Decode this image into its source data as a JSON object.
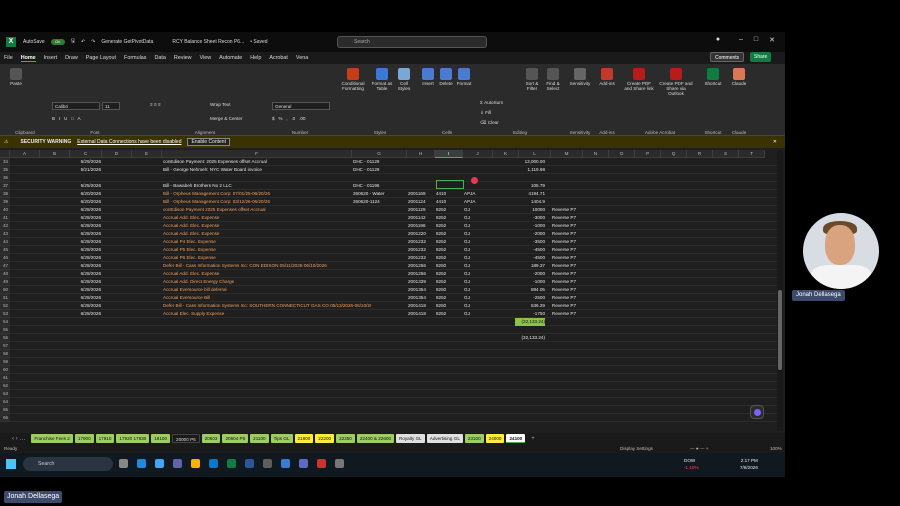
{
  "titlebar": {
    "autosave_label": "AutoSave",
    "autosave_state": "On",
    "macro_label": "Generate GetPivotData",
    "file_title": "RCY Balance Sheet Recon P6...",
    "saved_status": "• Saved",
    "search_placeholder": "Search"
  },
  "menu": {
    "items": [
      "File",
      "Home",
      "Insert",
      "Draw",
      "Page Layout",
      "Formulas",
      "Data",
      "Review",
      "View",
      "Automate",
      "Help",
      "Acrobat",
      "Vena"
    ],
    "active": "Home",
    "comments_label": "Comments",
    "share_label": "Share"
  },
  "ribbon": {
    "font_name": "Calibri",
    "font_size": "11",
    "number_format": "General",
    "wrap_text": "Wrap Text",
    "merge_center": "Merge & Center",
    "conditional_formatting": "Conditional Formatting",
    "format_as_table": "Format as Table",
    "cell_styles": "Cell Styles",
    "insert": "Insert",
    "delete": "Delete",
    "format": "Format",
    "autosum": "AutoSum",
    "fill": "Fill",
    "clear": "Clear",
    "sort_filter": "Sort & Filter",
    "find_select": "Find & Select",
    "sensitivity": "Sensitivity",
    "addins": "Add-ins",
    "create_pdf_link": "Create PDF and Share link",
    "create_pdf_outlook": "Create PDF and Share via Outlook",
    "shortcut": "Shortcut",
    "claude": "Claude",
    "paste": "Paste",
    "groups": [
      "Clipboard",
      "Font",
      "Alignment",
      "Number",
      "Styles",
      "Cells",
      "Editing",
      "Sensitivity",
      "Add-ins",
      "Adobe Acrobat",
      "Shortcut",
      "Claude"
    ]
  },
  "warning": {
    "title": "SECURITY WARNING",
    "message": "External Data Connections have been disabled",
    "button": "Enable Content"
  },
  "formula_bar": {
    "name_box": "I55",
    "fx": "fx"
  },
  "columns": [
    "A",
    "B",
    "C",
    "D",
    "E",
    "F",
    "G",
    "H",
    "I",
    "J",
    "K",
    "L",
    "M",
    "N",
    "O",
    "P",
    "Q",
    "R",
    "S",
    "T"
  ],
  "rows": [
    {
      "n": "34",
      "date": "5/29/2026",
      "desc": "conEdison Payment: 2025 Expenses offset Accrual",
      "g": "DHC - 01129",
      "h": "",
      "i": "",
      "j": "",
      "l": "13,000.00",
      "m": "",
      "desc_orange": false
    },
    {
      "n": "35",
      "date": "5/21/2026",
      "desc": "Bill - George Nehmeh: NYC Water Board invoice",
      "g": "DHC - 01129",
      "h": "",
      "i": "",
      "j": "",
      "l": "1,119.98",
      "m": "",
      "desc_orange": false
    },
    {
      "n": "36",
      "date": "",
      "desc": "",
      "g": "",
      "h": "",
      "i": "",
      "j": "",
      "l": "",
      "m": "",
      "desc_orange": false
    },
    {
      "n": "37",
      "date": "5/25/2026",
      "desc": "Bill - Bawabeh Brothers No 2 LLC",
      "g": "DHC - 01196",
      "h": "",
      "i": "",
      "j": "",
      "l": "105.79",
      "m": "",
      "desc_orange": false
    },
    {
      "n": "38",
      "date": "6/20/2026",
      "desc": "Bill - Orpheus Management Corp: 07/01/25-06/20/26",
      "g": "260620 - Water",
      "h": "2001169",
      "i": "4410",
      "j": "APJA",
      "l": "4194.71",
      "m": "",
      "desc_orange": true
    },
    {
      "n": "39",
      "date": "6/20/2026",
      "desc": "Bill - Orpheus Management Corp: 03/12/26-06/20/26",
      "g": "260620-1124",
      "h": "2001124",
      "i": "4410",
      "j": "APJA",
      "l": "1404.9",
      "m": "",
      "desc_orange": true
    },
    {
      "n": "40",
      "date": "6/28/2026",
      "desc": "conEdison Payment 2025 Expenses offset Accrual",
      "g": "",
      "h": "2001129",
      "i": "8252",
      "j": "GJ",
      "l": "10000",
      "m": "Reverse P7",
      "desc_orange": true
    },
    {
      "n": "41",
      "date": "6/28/2026",
      "desc": "Accrual Add. Elec. Expense",
      "g": "",
      "h": "2001142",
      "i": "8252",
      "j": "GJ",
      "l": "-3000",
      "m": "Reverse P7",
      "desc_orange": true
    },
    {
      "n": "42",
      "date": "6/28/2026",
      "desc": "Accrual Add. Elec. Expense",
      "g": "",
      "h": "2001196",
      "i": "8252",
      "j": "GJ",
      "l": "-1000",
      "m": "Reverse P7",
      "desc_orange": true
    },
    {
      "n": "43",
      "date": "6/28/2026",
      "desc": "Accrual Add. Elec. Expense",
      "g": "",
      "h": "2001220",
      "i": "8252",
      "j": "GJ",
      "l": "-2000",
      "m": "Reverse P7",
      "desc_orange": true
    },
    {
      "n": "44",
      "date": "6/28/2026",
      "desc": "Accrual P4 Elec. Expense",
      "g": "",
      "h": "2001232",
      "i": "8252",
      "j": "GJ",
      "l": "-3500",
      "m": "Reverse P7",
      "desc_orange": true
    },
    {
      "n": "45",
      "date": "6/28/2026",
      "desc": "Accrual P5 Elec. Expense",
      "g": "",
      "h": "2001232",
      "i": "8252",
      "j": "GJ",
      "l": "-4500",
      "m": "Reverse P7",
      "desc_orange": true
    },
    {
      "n": "46",
      "date": "6/28/2026",
      "desc": "Accrual P6 Elec. Expense",
      "g": "",
      "h": "2001232",
      "i": "8252",
      "j": "GJ",
      "l": "-4500",
      "m": "Reverse P7",
      "desc_orange": true
    },
    {
      "n": "47",
      "date": "6/28/2026",
      "desc": "Defer Bill - Cass Information Systems Inc: CON EDISON 05/11/2026-06/10/2026",
      "g": "",
      "h": "2001256",
      "i": "8250",
      "j": "GJ",
      "l": "189.37",
      "m": "Reverse P7",
      "desc_orange": true
    },
    {
      "n": "48",
      "date": "6/28/2026",
      "desc": "Accrual Add. Elec. Expense",
      "g": "",
      "h": "2001256",
      "i": "8252",
      "j": "GJ",
      "l": "-2000",
      "m": "Reverse P7",
      "desc_orange": true
    },
    {
      "n": "49",
      "date": "6/28/2026",
      "desc": "Accrual Add. Direct Energy Charge",
      "g": "",
      "h": "2001339",
      "i": "8252",
      "j": "GJ",
      "l": "-1000",
      "m": "Reverse P7",
      "desc_orange": true
    },
    {
      "n": "50",
      "date": "6/28/2026",
      "desc": "Accrual Eversource bill deferral",
      "g": "",
      "h": "2001354",
      "i": "8250",
      "j": "GJ",
      "l": "894.05",
      "m": "Reverse P7",
      "desc_orange": true
    },
    {
      "n": "51",
      "date": "6/28/2026",
      "desc": "Accrual Eversource Bill",
      "g": "",
      "h": "2001354",
      "i": "8252",
      "j": "GJ",
      "l": "-2500",
      "m": "Reverse P7",
      "desc_orange": true
    },
    {
      "n": "52",
      "date": "6/28/2026",
      "desc": "Defer Bill - Cass Information Systems Inc: SOUTHERN CONNECTICUT GAS CO 05/13/2026-06/10/2026",
      "g": "",
      "h": "2001418",
      "i": "8250",
      "j": "GJ",
      "l": "536.29",
      "m": "Reverse P7",
      "desc_orange": true
    },
    {
      "n": "53",
      "date": "6/28/2026",
      "desc": "Accrual Elec. Supply Expense",
      "g": "",
      "h": "2001418",
      "i": "8252",
      "j": "GJ",
      "l": "-1750",
      "m": "Reverse P7",
      "desc_orange": true
    },
    {
      "n": "54",
      "date": "",
      "desc": "",
      "g": "",
      "h": "",
      "i": "",
      "j": "",
      "l": "(32,133.24)",
      "m": "",
      "desc_orange": false,
      "l_green": true
    },
    {
      "n": "55",
      "date": "",
      "desc": "",
      "g": "",
      "h": "",
      "i": "",
      "j": "",
      "l": "",
      "m": "",
      "desc_orange": false
    },
    {
      "n": "56",
      "date": "",
      "desc": "",
      "g": "",
      "h": "",
      "i": "",
      "j": "",
      "l": "(32,133.24)",
      "m": "",
      "desc_orange": false
    },
    {
      "n": "57",
      "date": "",
      "desc": "",
      "g": "",
      "h": "",
      "i": "",
      "j": "",
      "l": "",
      "m": "",
      "desc_orange": false
    },
    {
      "n": "58",
      "date": "",
      "desc": "",
      "g": "",
      "h": "",
      "i": "",
      "j": "",
      "l": "",
      "m": "",
      "desc_orange": false
    },
    {
      "n": "59",
      "date": "",
      "desc": "",
      "g": "",
      "h": "",
      "i": "",
      "j": "",
      "l": "",
      "m": "",
      "desc_orange": false
    },
    {
      "n": "60",
      "date": "",
      "desc": "",
      "g": "",
      "h": "",
      "i": "",
      "j": "",
      "l": "",
      "m": "",
      "desc_orange": false
    },
    {
      "n": "61",
      "date": "",
      "desc": "",
      "g": "",
      "h": "",
      "i": "",
      "j": "",
      "l": "",
      "m": "",
      "desc_orange": false
    },
    {
      "n": "62",
      "date": "",
      "desc": "",
      "g": "",
      "h": "",
      "i": "",
      "j": "",
      "l": "",
      "m": "",
      "desc_orange": false
    },
    {
      "n": "63",
      "date": "",
      "desc": "",
      "g": "",
      "h": "",
      "i": "",
      "j": "",
      "l": "",
      "m": "",
      "desc_orange": false
    },
    {
      "n": "64",
      "date": "",
      "desc": "",
      "g": "",
      "h": "",
      "i": "",
      "j": "",
      "l": "",
      "m": "",
      "desc_orange": false
    },
    {
      "n": "65",
      "date": "",
      "desc": "",
      "g": "",
      "h": "",
      "i": "",
      "j": "",
      "l": "",
      "m": "",
      "desc_orange": false
    },
    {
      "n": "66",
      "date": "",
      "desc": "",
      "g": "",
      "h": "",
      "i": "",
      "j": "",
      "l": "",
      "m": "",
      "desc_orange": false
    }
  ],
  "sheet_tabs": [
    {
      "label": "Franchise Fees 2",
      "style": "g"
    },
    {
      "label": "17900",
      "style": "g"
    },
    {
      "label": "17910",
      "style": "g"
    },
    {
      "label": "17920 17930",
      "style": "g"
    },
    {
      "label": "18100",
      "style": "g"
    },
    {
      "label": "20000 P6",
      "style": "d"
    },
    {
      "label": "20603",
      "style": "g"
    },
    {
      "label": "20604 P6",
      "style": "g"
    },
    {
      "label": "21100",
      "style": "g"
    },
    {
      "label": "Tips GL",
      "style": "g"
    },
    {
      "label": "21800",
      "style": "y"
    },
    {
      "label": "22200",
      "style": "y"
    },
    {
      "label": "22350",
      "style": "g"
    },
    {
      "label": "22400 & 22600",
      "style": "g"
    },
    {
      "label": "Royalty GL",
      "style": "w"
    },
    {
      "label": "Advertising GL",
      "style": "w"
    },
    {
      "label": "23100",
      "style": "g"
    },
    {
      "label": "24000",
      "style": "y"
    },
    {
      "label": "24100",
      "style": "a"
    }
  ],
  "status": {
    "ready": "Ready",
    "display_settings": "Display Settings",
    "zoom": "100%"
  },
  "taskbar": {
    "search": "Search",
    "stock_name": "DOW",
    "stock_change": "-1.10%",
    "time": "2:17 PM",
    "date": "7/8/2026"
  },
  "participant": {
    "name": "Jonah Dellasega"
  },
  "presenter": {
    "name": "Jonah Dellasega"
  },
  "colors": {
    "accent": "#107c41",
    "green_tab": "#9ccc65",
    "yellow_tab": "#ffeb3b",
    "warning": "#3a3200",
    "highlight_cell": "#8bc34a",
    "orange_text": "#f0a060"
  }
}
